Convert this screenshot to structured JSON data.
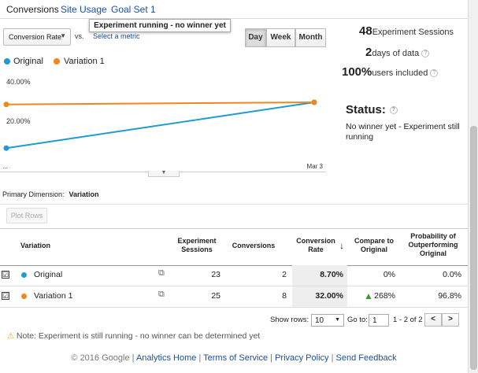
{
  "tabs": [
    {
      "label": "Conversions",
      "active": true
    },
    {
      "label": "Site Usage",
      "active": false
    },
    {
      "label": "Goal Set 1",
      "active": false
    }
  ],
  "toolbar": {
    "metric_select": "Conversion Rate",
    "vs_label": "vs.",
    "select_metric_link": "Select a metric",
    "tooltip": "Experiment running - no winner yet",
    "day": "Day",
    "week": "Week",
    "month": "Month"
  },
  "legend": [
    {
      "label": "Original",
      "color": "#1f9bd1"
    },
    {
      "label": "Variation 1",
      "color": "#f0861e"
    }
  ],
  "chart_data": {
    "type": "line",
    "x": [
      "...",
      "Mar 3"
    ],
    "series": [
      {
        "name": "Original",
        "color": "#1f9bd1",
        "values": [
          8.7,
          32.0
        ]
      },
      {
        "name": "Variation 1",
        "color": "#f0861e",
        "values": [
          30.9,
          32.0
        ]
      }
    ],
    "y_ticks": [
      "40.00%",
      "20.00%"
    ],
    "ylim": [
      0,
      48
    ],
    "grid": false
  },
  "stats": {
    "sessions_value": "48",
    "sessions_label": "Experiment Sessions",
    "days_value": "2",
    "days_label": "days of data",
    "users_value": "100%",
    "users_label": "users included",
    "q": "?"
  },
  "status": {
    "title": "Status:",
    "text": "No winner yet - Experiment still running"
  },
  "primary_dimension": {
    "label": "Primary Dimension:",
    "value": "Variation"
  },
  "plot_rows_label": "Plot Rows",
  "table": {
    "headers": {
      "variation": "Variation",
      "sessions": "Experiment Sessions",
      "conversions": "Conversions",
      "conv_rate": "Conversion Rate",
      "sort_arrow": "↓",
      "compare": "Compare to Original",
      "probability": "Probability of Outperforming Original"
    },
    "rows": [
      {
        "checked": "☑",
        "name": "Original",
        "color": "#1f9bd1",
        "sessions": "23",
        "conversions": "2",
        "conv_rate": "8.70%",
        "compare": "0%",
        "probability": "0.0%"
      },
      {
        "checked": "☑",
        "name": "Variation 1",
        "color": "#f0861e",
        "sessions": "25",
        "conversions": "8",
        "conv_rate": "32.00%",
        "compare": "268%",
        "probability": "96.8%"
      }
    ],
    "up_arrow_color": "#3a9a3a"
  },
  "pager": {
    "show_rows_label": "Show rows:",
    "rows_value": "10",
    "goto_label": "Go to:",
    "goto_value": "1",
    "range": "1 - 2 of 2",
    "prev": "<",
    "next": ">"
  },
  "note": "Note: Experiment is still running - no winner can be determined yet",
  "footer": {
    "copyright": "© 2016 Google",
    "sep": "|",
    "links": [
      "Analytics Home",
      "Terms of Service",
      "Privacy Policy",
      "Send Feedback"
    ]
  }
}
